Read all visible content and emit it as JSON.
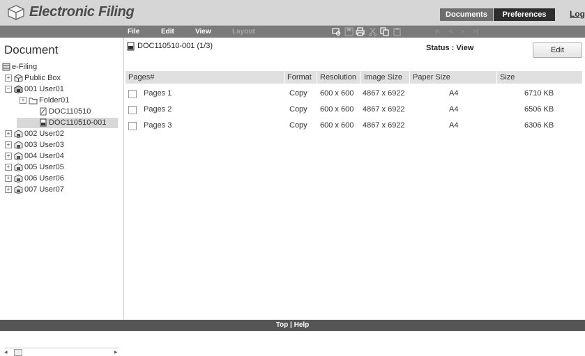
{
  "header": {
    "app_title": "Electronic Filing",
    "tabs": [
      {
        "label": "Documents"
      },
      {
        "label": "Preferences"
      }
    ],
    "logout_label": "Log"
  },
  "menubar": {
    "items": [
      "File",
      "Edit",
      "View",
      "Layout"
    ],
    "toolbar_icons": [
      "view-icon",
      "save-icon",
      "print-icon",
      "cut-icon",
      "copy-icon",
      "paste-icon"
    ],
    "nav": [
      "|<",
      "<",
      ">",
      ">|"
    ]
  },
  "tree": {
    "title": "Document",
    "items": [
      {
        "label": "e-Filing",
        "icon": "cabinet-icon"
      },
      {
        "label": "Public Box",
        "icon": "box-icon"
      },
      {
        "label": "001 User01",
        "icon": "user-box-icon"
      },
      {
        "label": "Folder01",
        "icon": "folder-icon"
      },
      {
        "label": "DOC110510",
        "icon": "document-icon"
      },
      {
        "label": "DOC110510-001",
        "icon": "document-icon"
      },
      {
        "label": "002 User02",
        "icon": "user-box-icon"
      },
      {
        "label": "003 User03",
        "icon": "user-box-icon"
      },
      {
        "label": "004 User04",
        "icon": "user-box-icon"
      },
      {
        "label": "005 User05",
        "icon": "user-box-icon"
      },
      {
        "label": "006 User06",
        "icon": "user-box-icon"
      },
      {
        "label": "007 User07",
        "icon": "user-box-icon"
      }
    ]
  },
  "document": {
    "title": "DOC110510-001  (1/3)",
    "status": "Status : View",
    "edit_label": "Edit"
  },
  "table": {
    "columns": [
      "Pages#",
      "Format",
      "Resolution",
      "Image Size",
      "Paper Size",
      "Size"
    ],
    "rows": [
      {
        "page": "Pages 1",
        "format": "Copy",
        "resolution": "600 x 600",
        "image_size": "4867 x 6922",
        "paper_size": "A4",
        "size": "6710 KB"
      },
      {
        "page": "Pages 2",
        "format": "Copy",
        "resolution": "600 x 600",
        "image_size": "4867 x 6922",
        "paper_size": "A4",
        "size": "6506 KB"
      },
      {
        "page": "Pages 3",
        "format": "Copy",
        "resolution": "600 x 600",
        "image_size": "4867 x 6922",
        "paper_size": "A4",
        "size": "6306 KB"
      }
    ]
  },
  "footer": {
    "links": "Top | Help"
  },
  "colors": {
    "header_bg": "#d6d6d6",
    "menubar_bg": "#7a7a7a",
    "footer_bg": "#555555",
    "table_header_bg": "#e0e0e0"
  }
}
